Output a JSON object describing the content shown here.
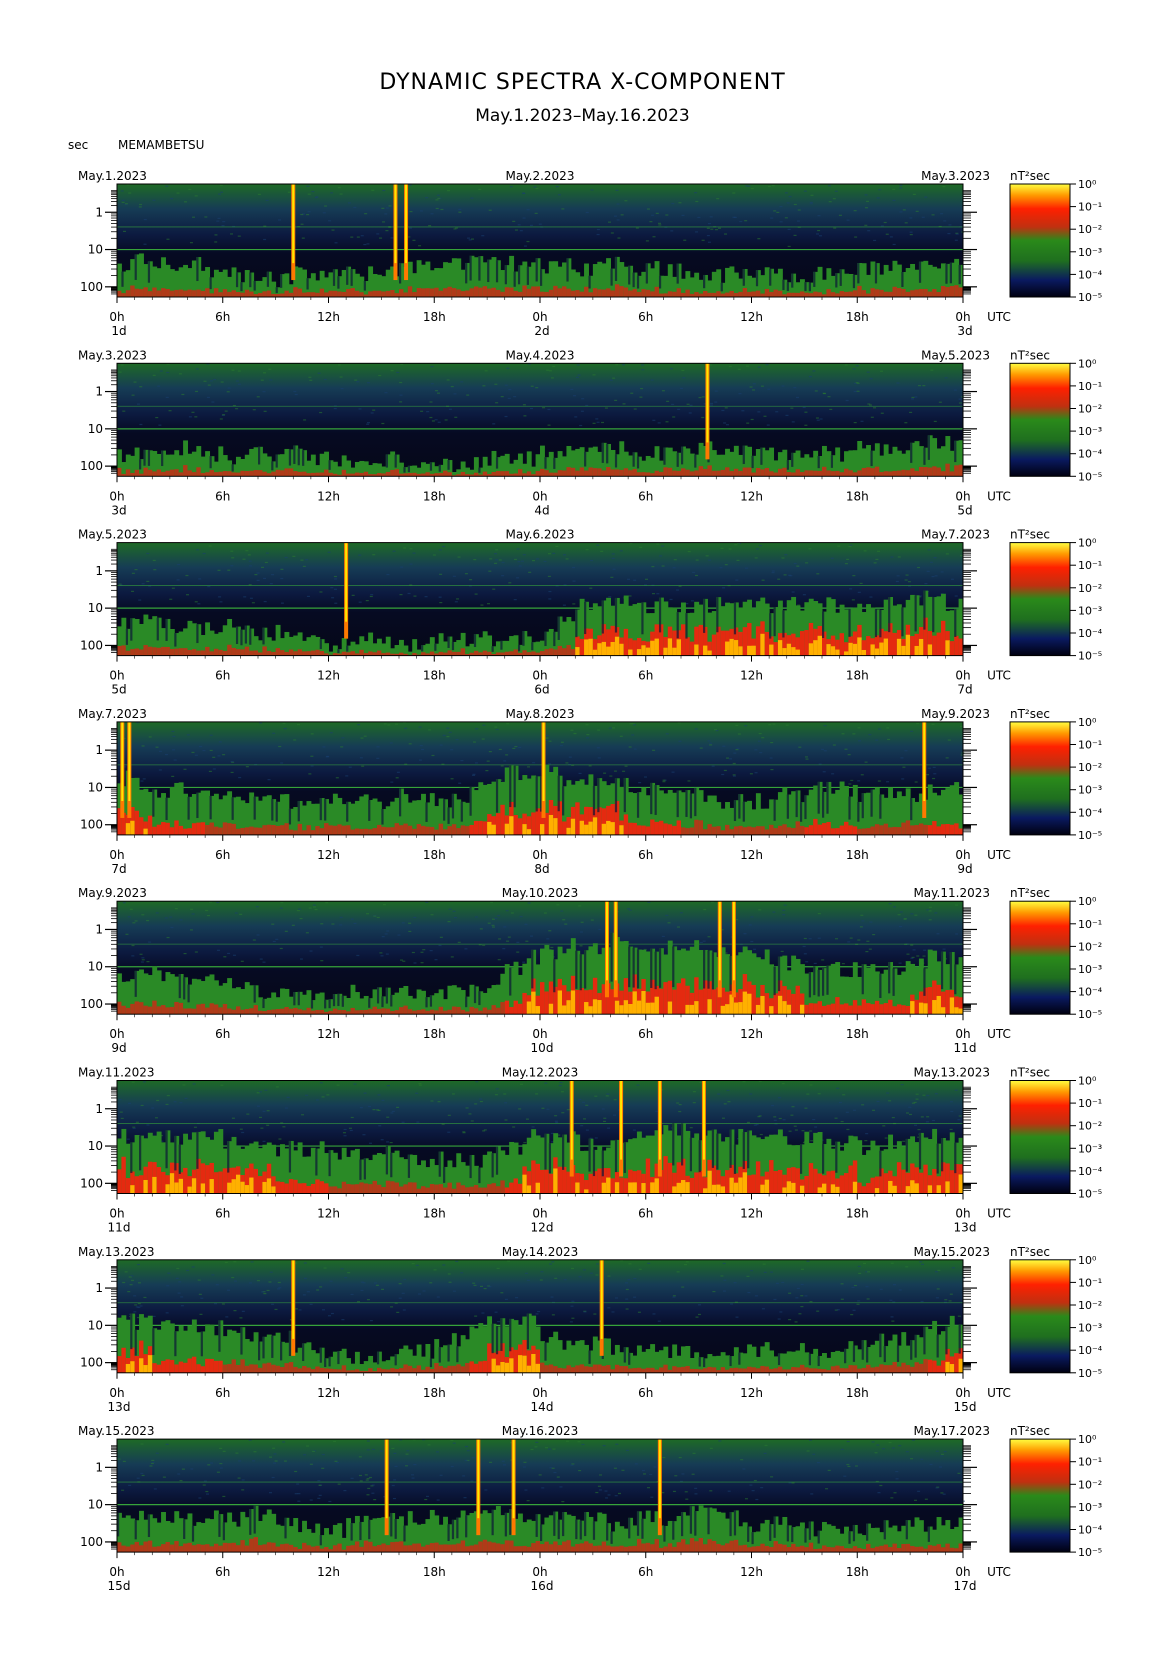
{
  "title": "DYNAMIC SPECTRA X-COMPONENT",
  "subtitle": "May.1.2023–May.16.2023",
  "unit_label": "sec",
  "station": "MEMAMBETSU",
  "colorbar_unit": "nT²sec",
  "colorbar_ticks": [
    "10⁰",
    "10⁻¹",
    "10⁻²",
    "10⁻³",
    "10⁻⁴",
    "10⁻⁵"
  ],
  "colors": {
    "background_dark": "#0a0f2a",
    "low_power": "#1a3a8a",
    "mid_power": "#1f7a1f",
    "high_power": "#e02010",
    "peak_power": "#ffe800",
    "harmonic_line": "#3cb43c"
  },
  "chart_data": {
    "type": "heatmap",
    "y_axis": {
      "label": "sec",
      "ticks": [
        "1",
        "10",
        "100"
      ],
      "scale": "log"
    },
    "x_axis": {
      "ticks": [
        "0h",
        "6h",
        "12h",
        "18h",
        "0h",
        "6h",
        "12h",
        "18h",
        "0h"
      ],
      "unit": "UTC"
    },
    "colorbar": {
      "label": "nT²sec",
      "range": [
        "10⁻⁵",
        "10⁰"
      ],
      "scale": "log"
    },
    "panels": [
      {
        "left_date": "May.1.2023",
        "center_date": "May.2.2023",
        "right_date": "May.3.2023",
        "day_labels": [
          "1d",
          "2d",
          "3d"
        ],
        "spikes_hours": [
          10,
          15.8,
          16.4
        ],
        "activity": [
          0.3,
          0.35,
          0.3,
          0.3,
          0.3,
          0.2,
          0.25,
          0.2,
          0.2,
          0.15,
          0.2,
          0.2,
          0.2,
          0.2,
          0.2,
          0.25,
          0.25,
          0.3,
          0.3,
          0.3,
          0.3,
          0.3,
          0.3,
          0.3,
          0.25,
          0.3,
          0.25,
          0.3,
          0.3,
          0.25,
          0.25,
          0.25,
          0.2,
          0.2,
          0.2,
          0.2,
          0.2,
          0.2,
          0.2,
          0.2,
          0.2,
          0.25,
          0.25,
          0.25,
          0.25,
          0.3,
          0.3,
          0.35
        ]
      },
      {
        "left_date": "May.3.2023",
        "center_date": "May.4.2023",
        "right_date": "May.5.2023",
        "day_labels": [
          "3d",
          "4d",
          "5d"
        ],
        "spikes_hours": [
          33.5
        ],
        "activity": [
          0.2,
          0.2,
          0.25,
          0.25,
          0.2,
          0.2,
          0.15,
          0.2,
          0.2,
          0.2,
          0.2,
          0.15,
          0.15,
          0.1,
          0.1,
          0.15,
          0.15,
          0.15,
          0.1,
          0.1,
          0.1,
          0.15,
          0.15,
          0.15,
          0.2,
          0.2,
          0.2,
          0.25,
          0.25,
          0.2,
          0.2,
          0.2,
          0.2,
          0.25,
          0.25,
          0.2,
          0.2,
          0.2,
          0.2,
          0.2,
          0.2,
          0.2,
          0.25,
          0.25,
          0.25,
          0.3,
          0.3,
          0.3
        ]
      },
      {
        "left_date": "May.5.2023",
        "center_date": "May.6.2023",
        "right_date": "May.7.2023",
        "day_labels": [
          "5d",
          "6d",
          "7d"
        ],
        "spikes_hours": [
          13
        ],
        "activity": [
          0.3,
          0.3,
          0.3,
          0.25,
          0.25,
          0.25,
          0.25,
          0.2,
          0.2,
          0.2,
          0.15,
          0.15,
          0.1,
          0.1,
          0.15,
          0.1,
          0.1,
          0.1,
          0.15,
          0.15,
          0.15,
          0.15,
          0.15,
          0.15,
          0.2,
          0.3,
          0.45,
          0.5,
          0.5,
          0.5,
          0.45,
          0.45,
          0.45,
          0.45,
          0.45,
          0.45,
          0.45,
          0.45,
          0.45,
          0.45,
          0.45,
          0.45,
          0.45,
          0.45,
          0.5,
          0.5,
          0.5,
          0.45
        ]
      },
      {
        "left_date": "May.7.2023",
        "center_date": "May.8.2023",
        "right_date": "May.9.2023",
        "day_labels": [
          "7d",
          "8d",
          "9d"
        ],
        "spikes_hours": [
          0.3,
          0.7,
          24.2,
          45.8
        ],
        "activity": [
          0.5,
          0.45,
          0.4,
          0.4,
          0.4,
          0.35,
          0.35,
          0.35,
          0.3,
          0.3,
          0.3,
          0.3,
          0.3,
          0.3,
          0.3,
          0.3,
          0.35,
          0.35,
          0.3,
          0.3,
          0.4,
          0.45,
          0.55,
          0.55,
          0.55,
          0.5,
          0.5,
          0.45,
          0.45,
          0.4,
          0.4,
          0.4,
          0.35,
          0.35,
          0.3,
          0.3,
          0.3,
          0.35,
          0.35,
          0.4,
          0.4,
          0.4,
          0.35,
          0.35,
          0.35,
          0.35,
          0.4,
          0.4
        ]
      },
      {
        "left_date": "May.9.2023",
        "center_date": "May.10.2023",
        "right_date": "May.11.2023",
        "day_labels": [
          "9d",
          "10d",
          "11d"
        ],
        "spikes_hours": [
          27.8,
          28.3,
          34.2,
          35
        ],
        "activity": [
          0.35,
          0.35,
          0.35,
          0.3,
          0.3,
          0.3,
          0.3,
          0.25,
          0.2,
          0.2,
          0.2,
          0.2,
          0.2,
          0.2,
          0.2,
          0.2,
          0.2,
          0.2,
          0.2,
          0.2,
          0.2,
          0.3,
          0.4,
          0.5,
          0.55,
          0.6,
          0.6,
          0.6,
          0.65,
          0.6,
          0.6,
          0.6,
          0.6,
          0.6,
          0.55,
          0.55,
          0.5,
          0.45,
          0.45,
          0.4,
          0.4,
          0.4,
          0.4,
          0.4,
          0.4,
          0.45,
          0.5,
          0.5
        ]
      },
      {
        "left_date": "May.11.2023",
        "center_date": "May.12.2023",
        "right_date": "May.13.2023",
        "day_labels": [
          "11d",
          "12d",
          "13d"
        ],
        "spikes_hours": [
          25.8,
          28.6,
          30.8,
          33.3
        ],
        "activity": [
          0.5,
          0.5,
          0.5,
          0.5,
          0.5,
          0.5,
          0.45,
          0.45,
          0.45,
          0.4,
          0.4,
          0.4,
          0.35,
          0.35,
          0.35,
          0.35,
          0.3,
          0.3,
          0.3,
          0.3,
          0.3,
          0.35,
          0.4,
          0.5,
          0.5,
          0.5,
          0.45,
          0.45,
          0.5,
          0.5,
          0.55,
          0.55,
          0.55,
          0.5,
          0.5,
          0.5,
          0.55,
          0.55,
          0.5,
          0.5,
          0.45,
          0.45,
          0.4,
          0.45,
          0.45,
          0.5,
          0.5,
          0.5
        ]
      },
      {
        "left_date": "May.13.2023",
        "center_date": "May.14.2023",
        "right_date": "May.15.2023",
        "day_labels": [
          "13d",
          "14d",
          "15d"
        ],
        "spikes_hours": [
          10,
          27.5
        ],
        "activity": [
          0.5,
          0.45,
          0.4,
          0.4,
          0.4,
          0.4,
          0.35,
          0.35,
          0.3,
          0.3,
          0.25,
          0.2,
          0.15,
          0.15,
          0.15,
          0.15,
          0.2,
          0.2,
          0.25,
          0.3,
          0.4,
          0.45,
          0.45,
          0.45,
          0.3,
          0.25,
          0.25,
          0.25,
          0.2,
          0.2,
          0.2,
          0.2,
          0.2,
          0.2,
          0.2,
          0.2,
          0.2,
          0.2,
          0.2,
          0.2,
          0.2,
          0.25,
          0.25,
          0.3,
          0.3,
          0.35,
          0.4,
          0.45
        ]
      },
      {
        "left_date": "May.15.2023",
        "center_date": "May.16.2023",
        "right_date": "May.17.2023",
        "day_labels": [
          "15d",
          "16d",
          "17d"
        ],
        "spikes_hours": [
          15.3,
          20.5,
          22.5,
          30.8
        ],
        "activity": [
          0.35,
          0.35,
          0.3,
          0.3,
          0.3,
          0.3,
          0.3,
          0.35,
          0.35,
          0.3,
          0.25,
          0.2,
          0.2,
          0.25,
          0.25,
          0.3,
          0.3,
          0.3,
          0.3,
          0.3,
          0.35,
          0.35,
          0.35,
          0.3,
          0.3,
          0.3,
          0.3,
          0.3,
          0.25,
          0.3,
          0.3,
          0.3,
          0.35,
          0.35,
          0.3,
          0.3,
          0.25,
          0.25,
          0.25,
          0.2,
          0.2,
          0.2,
          0.2,
          0.25,
          0.25,
          0.25,
          0.25,
          0.25
        ]
      }
    ]
  }
}
